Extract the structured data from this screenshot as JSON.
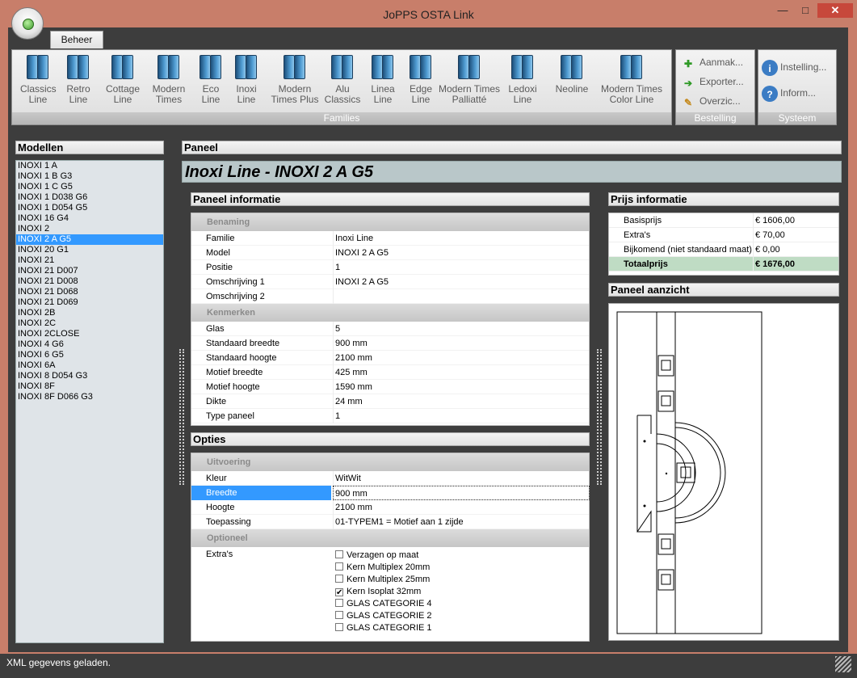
{
  "window": {
    "title": "JoPPS OSTA Link",
    "minimize": "—",
    "maximize": "□",
    "close": "✕"
  },
  "ribbon": {
    "tab": "Beheer",
    "families": {
      "label": "Families",
      "items": [
        {
          "l1": "Classics",
          "l2": "Line"
        },
        {
          "l1": "Retro",
          "l2": "Line"
        },
        {
          "l1": "Cottage",
          "l2": "Line"
        },
        {
          "l1": "Modern",
          "l2": "Times"
        },
        {
          "l1": "Eco",
          "l2": "Line"
        },
        {
          "l1": "Inoxi",
          "l2": "Line"
        },
        {
          "l1": "Modern",
          "l2": "Times Plus"
        },
        {
          "l1": "Alu",
          "l2": "Classics"
        },
        {
          "l1": "Linea",
          "l2": "Line"
        },
        {
          "l1": "Edge",
          "l2": "Line"
        },
        {
          "l1": "Modern Times",
          "l2": "Palliatté"
        },
        {
          "l1": "Ledoxi",
          "l2": "Line"
        },
        {
          "l1": "Neoline",
          "l2": ""
        },
        {
          "l1": "Modern Times",
          "l2": "Color Line"
        }
      ]
    },
    "bestelling": {
      "label": "Bestelling",
      "items": [
        "Aanmak...",
        "Exporter...",
        "Overzic..."
      ]
    },
    "systeem": {
      "label": "Systeem",
      "items": [
        "Instelling...",
        "Inform..."
      ]
    }
  },
  "modellen": {
    "header": "Modellen",
    "items": [
      "INOXI 1 A",
      "INOXI 1 B G3",
      "INOXI 1 C G5",
      "INOXI 1 D038 G6",
      "INOXI 1 D054 G5",
      "INOXI 16 G4",
      "INOXI 2",
      "INOXI 2 A G5",
      "INOXI 20 G1",
      "INOXI 21",
      "INOXI 21 D007",
      "INOXI 21 D008",
      "INOXI 21 D068",
      "INOXI 21 D069",
      "INOXI 2B",
      "INOXI 2C",
      "INOXI 2CLOSE",
      "INOXI 4 G6",
      "INOXI 6  G5",
      "INOXI 6A",
      "INOXI 8 D054 G3",
      "INOXI 8F",
      "INOXI 8F D066 G3"
    ],
    "selected": "INOXI 2 A G5"
  },
  "paneel": {
    "header": "Paneel",
    "title": "Inoxi Line - INOXI 2 A G5",
    "info_header": "Paneel informatie",
    "benaming": {
      "label": "Benaming",
      "rows": [
        {
          "k": "Familie",
          "v": "Inoxi Line"
        },
        {
          "k": "Model",
          "v": "INOXI 2 A G5"
        },
        {
          "k": "Positie",
          "v": "1"
        },
        {
          "k": "Omschrijving 1",
          "v": "INOXI 2 A G5"
        },
        {
          "k": "Omschrijving 2",
          "v": ""
        }
      ]
    },
    "kenmerken": {
      "label": "Kenmerken",
      "rows": [
        {
          "k": "Glas",
          "v": "5"
        },
        {
          "k": "Standaard breedte",
          "v": "900 mm"
        },
        {
          "k": "Standaard hoogte",
          "v": "2100 mm"
        },
        {
          "k": "Motief breedte",
          "v": "425 mm"
        },
        {
          "k": "Motief hoogte",
          "v": "1590 mm"
        },
        {
          "k": "Dikte",
          "v": "24 mm"
        },
        {
          "k": "Type paneel",
          "v": "1"
        }
      ]
    }
  },
  "opties": {
    "header": "Opties",
    "uitvoering": {
      "label": "Uitvoering",
      "rows": [
        {
          "k": "Kleur",
          "v": "WitWit"
        },
        {
          "k": "Breedte",
          "v": "900 mm"
        },
        {
          "k": "Hoogte",
          "v": "2100 mm"
        },
        {
          "k": "Toepassing",
          "v": "01-TYPEM1 = Motief aan 1 zijde"
        }
      ]
    },
    "optioneel": {
      "label": "Optioneel",
      "extras_label": "Extra's",
      "extras": [
        {
          "label": "Verzagen op maat",
          "checked": false
        },
        {
          "label": "Kern Multiplex 20mm",
          "checked": false
        },
        {
          "label": "Kern Multiplex 25mm",
          "checked": false
        },
        {
          "label": "Kern Isoplat 32mm",
          "checked": true
        },
        {
          "label": "GLAS CATEGORIE  4",
          "checked": false
        },
        {
          "label": "GLAS CATEGORIE  2",
          "checked": false
        },
        {
          "label": "GLAS CATEGORIE  1",
          "checked": false
        }
      ]
    }
  },
  "prijs": {
    "header": "Prijs informatie",
    "rows": [
      {
        "k": "Basisprijs",
        "v": "€ 1606,00"
      },
      {
        "k": "Extra's",
        "v": "€ 70,00"
      },
      {
        "k": "Bijkomend (niet standaard maat)",
        "v": "€ 0,00"
      },
      {
        "k": "Totaalprijs",
        "v": "€ 1676,00"
      }
    ]
  },
  "aanzicht": {
    "header": "Paneel aanzicht"
  },
  "status": {
    "text": "XML gegevens geladen."
  }
}
